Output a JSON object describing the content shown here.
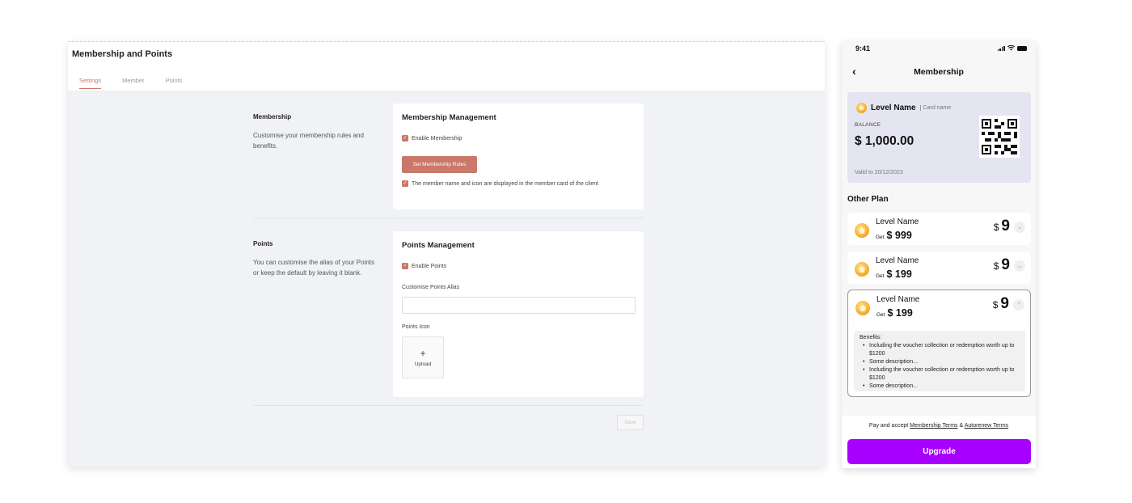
{
  "admin": {
    "title": "Membership and Points",
    "tabs": [
      "Settings",
      "Member",
      "Points"
    ],
    "active_tab": "Settings",
    "membership_section": {
      "label": "Membership",
      "description": "Customise your membership rules and benefits.",
      "card_title": "Membership Management",
      "enable_label": "Enable Membership",
      "rules_button": "Set Membership Rules",
      "display_label": "The member name and icon are displayed in the member card of the client"
    },
    "points_section": {
      "label": "Points",
      "description": "You can customise the alias of your Points or keep the default by leaving it blank.",
      "card_title": "Points Management",
      "enable_label": "Enable Points",
      "alias_label": "Customise Points Alias",
      "alias_value": "",
      "icon_label": "Points Icon",
      "upload_plus": "+",
      "upload_label": "Upload"
    },
    "save_button": "Save",
    "accent_color": "#c9786a"
  },
  "phone": {
    "time": "9:41",
    "nav_title": "Membership",
    "back_icon": "chevron-left-icon",
    "card": {
      "level_name": "Level Name",
      "card_name": "Card name",
      "balance_label": "BALANCE",
      "balance": "$ 1,000.00",
      "valid_to": "Valid to 20/12/2023"
    },
    "other_plan_title": "Other Plan",
    "plans": [
      {
        "name": "Level Name",
        "get_label": "Get",
        "get_amount": "$ 999",
        "currency": "$",
        "price": "9",
        "expanded": false
      },
      {
        "name": "Level Name",
        "get_label": "Get",
        "get_amount": "$ 199",
        "currency": "$",
        "price": "9",
        "expanded": false
      },
      {
        "name": "Level Name",
        "get_label": "Get",
        "get_amount": "$ 199",
        "currency": "$",
        "price": "9",
        "expanded": true,
        "benefits_title": "Benefits:",
        "benefits": [
          "Including the voucher collection or redemption worth up to $1200",
          "Some description...",
          "Including the voucher collection or redemption worth up to $1200",
          "Some description..."
        ]
      }
    ],
    "terms": {
      "prefix": "Pay and accept",
      "link1": "Membership Terms",
      "amp": "&",
      "link2": "Autorenew Terms"
    },
    "upgrade_button": "Upgrade",
    "upgrade_color": "#a800ff"
  }
}
